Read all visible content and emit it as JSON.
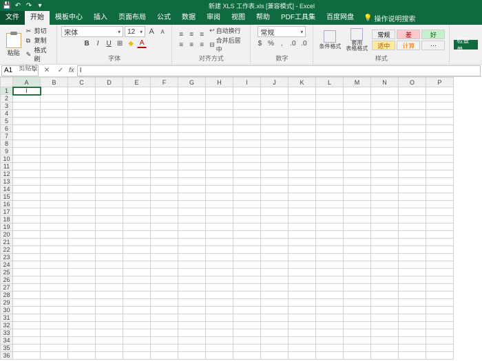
{
  "title": "新建 XLS 工作表.xls [兼容模式] - Excel",
  "qat": {
    "save": "💾",
    "undo": "↶",
    "redo": "↷",
    "more": "▾"
  },
  "menu": {
    "file": "文件",
    "home": "开始",
    "template": "模板中心",
    "insert": "插入",
    "layout": "页面布局",
    "formula": "公式",
    "data": "数据",
    "review": "审阅",
    "view": "视图",
    "help": "帮助",
    "pdf": "PDF工具集",
    "baidu": "百度网盘",
    "search_icon": "💡",
    "search": "操作说明搜索"
  },
  "ribbon": {
    "clipboard": {
      "paste": "粘贴",
      "cut": "剪切",
      "copy": "复制",
      "format_painter": "格式刷",
      "label": "剪贴板"
    },
    "font": {
      "name": "宋体",
      "size": "12",
      "grow": "A",
      "shrink": "A",
      "bold": "B",
      "italic": "I",
      "underline": "U",
      "border": "⊞",
      "fill": "◆",
      "color": "A",
      "label": "字体"
    },
    "align": {
      "wrap": "自动换行",
      "merge": "合并后居中",
      "label": "对齐方式"
    },
    "number": {
      "format": "常规",
      "label": "数字"
    },
    "styles": {
      "cond": "条件格式",
      "table": "套用\n表格格式",
      "general": "常规",
      "bad": "差",
      "good": "好",
      "check": "适中",
      "calc": "计算",
      "label": "样式"
    },
    "edit": {
      "btn": "检查单"
    }
  },
  "namebox": {
    "ref": "A1",
    "cancel": "✕",
    "confirm": "✓",
    "fx": "fx",
    "formula": "I"
  },
  "grid": {
    "cols": [
      "A",
      "B",
      "C",
      "D",
      "E",
      "F",
      "G",
      "H",
      "I",
      "J",
      "K",
      "L",
      "M",
      "N",
      "O",
      "P"
    ],
    "rows": [
      "1",
      "2",
      "3",
      "4",
      "5",
      "6",
      "7",
      "8",
      "9",
      "10",
      "11",
      "12",
      "13",
      "14",
      "15",
      "16",
      "17",
      "18",
      "19",
      "20",
      "21",
      "22",
      "23",
      "24",
      "25",
      "26",
      "27",
      "28",
      "29",
      "30",
      "31",
      "32",
      "33",
      "34",
      "35",
      "36"
    ],
    "active": "A1",
    "cursor": "I"
  }
}
